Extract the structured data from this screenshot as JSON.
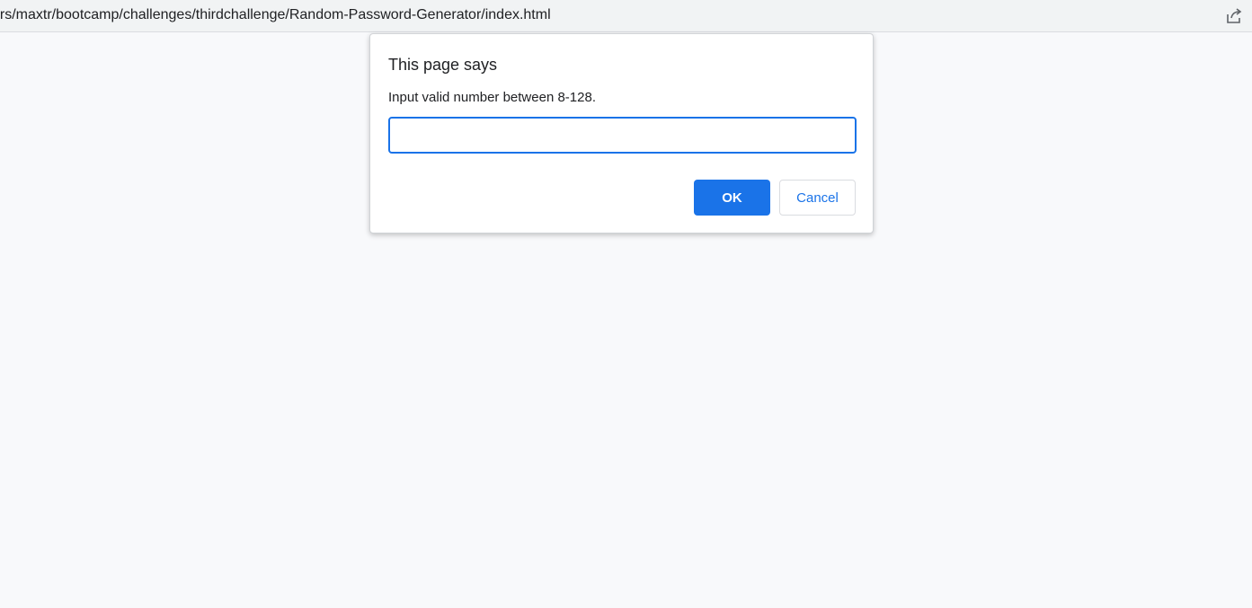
{
  "browser": {
    "url": "ers/maxtr/bootcamp/challenges/thirdchallenge/Random-Password-Generator/index.html",
    "share_icon": "share-icon"
  },
  "dialog": {
    "title": "This page says",
    "message": "Input valid number between 8-128.",
    "input_value": "",
    "ok_label": "OK",
    "cancel_label": "Cancel"
  },
  "colors": {
    "accent": "#1a73e8",
    "page_background": "#f8f9fb",
    "toolbar_background": "#f1f3f4"
  }
}
